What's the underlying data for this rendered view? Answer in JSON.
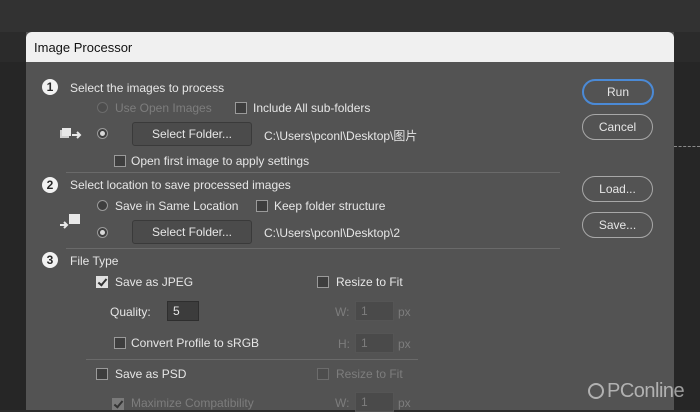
{
  "dialog": {
    "title": "Image Processor"
  },
  "section1": {
    "number": "1",
    "heading": "Select the images to process",
    "use_open_images": "Use Open Images",
    "include_subfolders": "Include All sub-folders",
    "select_folder_button": "Select Folder...",
    "folder_path": "C:\\Users\\pconl\\Desktop\\图片",
    "open_first_image": "Open first image to apply settings"
  },
  "section2": {
    "number": "2",
    "heading": "Select location to save processed images",
    "save_same_location": "Save in Same Location",
    "keep_folder_structure": "Keep folder structure",
    "select_folder_button": "Select Folder...",
    "folder_path": "C:\\Users\\pconl\\Desktop\\2"
  },
  "section3": {
    "number": "3",
    "heading": "File Type",
    "save_as_jpeg": "Save as JPEG",
    "resize_to_fit": "Resize to Fit",
    "quality_label": "Quality:",
    "quality_value": "5",
    "w_label": "W:",
    "h_label": "H:",
    "w_value": "1",
    "h_value": "1",
    "unit": "px",
    "convert_profile": "Convert Profile to sRGB",
    "save_as_psd": "Save as PSD",
    "resize_to_fit_psd": "Resize to Fit",
    "maximize_compat": "Maximize Compatibility",
    "w_value_psd": "1"
  },
  "buttons": {
    "run": "Run",
    "cancel": "Cancel",
    "load": "Load...",
    "save": "Save..."
  },
  "watermark": {
    "text": "PConline"
  },
  "colors": {
    "dialog_bg": "#535353",
    "titlebar_bg": "#f0f0f0",
    "run_border": "#4b8ad6"
  }
}
